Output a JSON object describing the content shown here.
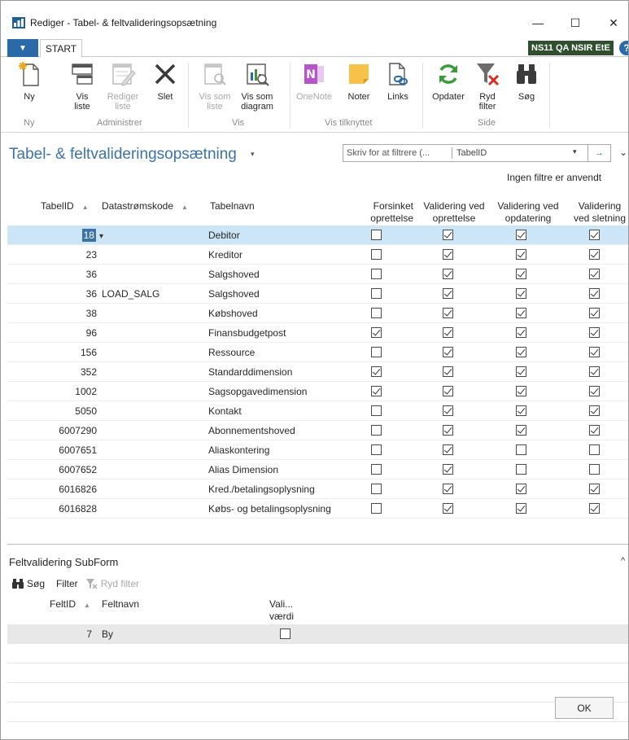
{
  "window": {
    "title": "Rediger - Tabel- & feltvalideringsopsætning",
    "minimize": "—",
    "maximize": "☐",
    "close": "✕"
  },
  "ribbon_tabs": {
    "file_glyph": "▼",
    "start": "START",
    "company": "NS11 QA NSIR EtE",
    "help": "?"
  },
  "ribbon": {
    "buttons": [
      {
        "label": "Ny",
        "icon": "new-document-icon",
        "enabled": true
      },
      {
        "label": "Vis\nliste",
        "icon": "view-list-icon",
        "enabled": true
      },
      {
        "label": "Rediger\nliste",
        "icon": "edit-list-icon",
        "enabled": false
      },
      {
        "label": "Slet",
        "icon": "delete-x-icon",
        "enabled": true
      },
      {
        "label": "Vis som\nliste",
        "icon": "view-as-list-icon",
        "enabled": false
      },
      {
        "label": "Vis som\ndiagram",
        "icon": "view-as-chart-icon",
        "enabled": true
      },
      {
        "label": "OneNote",
        "icon": "onenote-icon",
        "enabled": false
      },
      {
        "label": "Noter",
        "icon": "notes-icon",
        "enabled": true
      },
      {
        "label": "Links",
        "icon": "links-icon",
        "enabled": true
      },
      {
        "label": "Opdater",
        "icon": "refresh-icon",
        "enabled": true
      },
      {
        "label": "Ryd\nfilter",
        "icon": "clear-filter-icon",
        "enabled": true
      },
      {
        "label": "Søg",
        "icon": "binoculars-icon",
        "enabled": true
      }
    ],
    "groups": [
      "Ny",
      "Administrer",
      "Vis",
      "Vis tilknyttet",
      "Side"
    ]
  },
  "page": {
    "title": "Tabel- & feltvalideringsopsætning",
    "title_caret": "▾",
    "filter_placeholder": "Skriv for at filtrere (...",
    "filter_field": "TabelID",
    "filter_dropdown": "▾",
    "filter_go": "→",
    "collapse": "⌄",
    "no_filters": "Ingen filtre er anvendt"
  },
  "grid": {
    "columns": {
      "tabelid": "TabelID",
      "datastromskode": "Datastrømskode",
      "tabelnavn": "Tabelnavn",
      "forsinket_1": "Forsinket",
      "forsinket_2": "oprettelse",
      "val_opr_1": "Validering ved",
      "val_opr_2": "oprettelse",
      "val_opd_1": "Validering ved",
      "val_opd_2": "opdatering",
      "val_slet_1": "Validering",
      "val_slet_2": "ved sletning"
    },
    "sort_indicator": "▲",
    "rows": [
      {
        "id": "18",
        "ds": "",
        "name": "Debitor",
        "forsinket": false,
        "opr": true,
        "opd": true,
        "slet": true,
        "selected": true
      },
      {
        "id": "23",
        "ds": "",
        "name": "Kreditor",
        "forsinket": false,
        "opr": true,
        "opd": true,
        "slet": true
      },
      {
        "id": "36",
        "ds": "",
        "name": "Salgshoved",
        "forsinket": false,
        "opr": true,
        "opd": true,
        "slet": true
      },
      {
        "id": "36",
        "ds": "LOAD_SALG",
        "name": "Salgshoved",
        "forsinket": false,
        "opr": true,
        "opd": true,
        "slet": true
      },
      {
        "id": "38",
        "ds": "",
        "name": "Købshoved",
        "forsinket": false,
        "opr": true,
        "opd": true,
        "slet": true
      },
      {
        "id": "96",
        "ds": "",
        "name": "Finansbudgetpost",
        "forsinket": true,
        "opr": true,
        "opd": true,
        "slet": true
      },
      {
        "id": "156",
        "ds": "",
        "name": "Ressource",
        "forsinket": false,
        "opr": true,
        "opd": true,
        "slet": true
      },
      {
        "id": "352",
        "ds": "",
        "name": "Standarddimension",
        "forsinket": true,
        "opr": true,
        "opd": true,
        "slet": true
      },
      {
        "id": "1002",
        "ds": "",
        "name": "Sagsopgavedimension",
        "forsinket": true,
        "opr": true,
        "opd": true,
        "slet": true
      },
      {
        "id": "5050",
        "ds": "",
        "name": "Kontakt",
        "forsinket": false,
        "opr": true,
        "opd": true,
        "slet": true
      },
      {
        "id": "6007290",
        "ds": "",
        "name": "Abonnementshoved",
        "forsinket": false,
        "opr": true,
        "opd": true,
        "slet": true
      },
      {
        "id": "6007651",
        "ds": "",
        "name": "Aliaskontering",
        "forsinket": false,
        "opr": true,
        "opd": false,
        "slet": false
      },
      {
        "id": "6007652",
        "ds": "",
        "name": "Alias Dimension",
        "forsinket": false,
        "opr": true,
        "opd": false,
        "slet": false
      },
      {
        "id": "6016826",
        "ds": "",
        "name": "Kred./betalingsoplysning",
        "forsinket": false,
        "opr": true,
        "opd": true,
        "slet": true
      },
      {
        "id": "6016828",
        "ds": "",
        "name": "Købs- og betalingsoplysning",
        "forsinket": false,
        "opr": true,
        "opd": true,
        "slet": true
      }
    ]
  },
  "subform": {
    "title": "Feltvalidering SubForm",
    "collapse": "^",
    "toolbar": {
      "search": "Søg",
      "filter": "Filter",
      "clear_filter": "Ryd filter"
    },
    "columns": {
      "feltid": "FeltID",
      "feltnavn": "Feltnavn",
      "vali_1": "Vali...",
      "vali_2": "værdi"
    },
    "rows": [
      {
        "id": "7",
        "name": "By",
        "checked": false,
        "selected": true
      }
    ]
  },
  "footer": {
    "ok": "OK"
  },
  "colors": {
    "accent": "#3b73a9",
    "selected_row": "#cde6f7",
    "company_badge": "#2f4f2f"
  }
}
